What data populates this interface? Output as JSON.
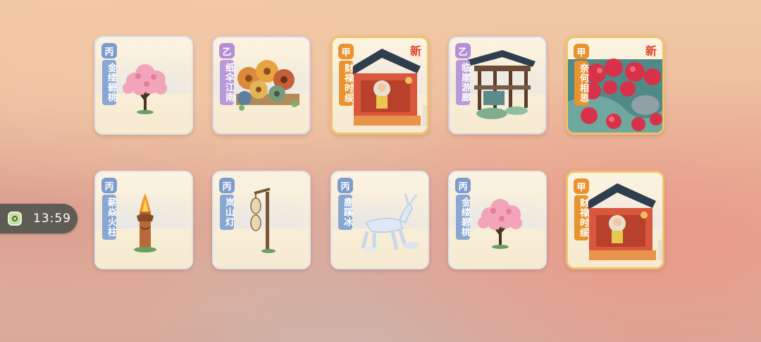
{
  "timer": {
    "icon": "frog-clock-icon",
    "time": "13:59"
  },
  "items": [
    {
      "grade": "丙",
      "name": "金缕碧桃",
      "new": false,
      "art": "peach-tree"
    },
    {
      "grade": "乙",
      "name": "纸伞江南",
      "new": false,
      "art": "umbrellas"
    },
    {
      "grade": "甲",
      "name": "财禄时绥",
      "new": true,
      "new_label": "新",
      "art": "fortune-shop"
    },
    {
      "grade": "乙",
      "name": "临崖游廊",
      "new": false,
      "art": "cliff-pavilion"
    },
    {
      "grade": "甲",
      "name": "奈何相思",
      "new": true,
      "new_label": "新",
      "art": "red-flowers"
    },
    {
      "grade": "丙",
      "name": "薪焱火柱",
      "new": false,
      "art": "fire-pillar"
    },
    {
      "grade": "丙",
      "name": "岚山灯",
      "new": false,
      "art": "lantern-post"
    },
    {
      "grade": "丙",
      "name": "鹿蹊冰",
      "new": false,
      "art": "ice-deer"
    },
    {
      "grade": "丙",
      "name": "金缕碧桃",
      "new": false,
      "art": "peach-tree"
    },
    {
      "grade": "甲",
      "name": "财禄时绥",
      "new": false,
      "art": "fortune-shop"
    }
  ],
  "colors": {
    "grade_jia": "#e8932e",
    "grade_yi": "#b58fd6",
    "grade_bing": "#7d9bcc",
    "new_tag": "#e0422e"
  }
}
